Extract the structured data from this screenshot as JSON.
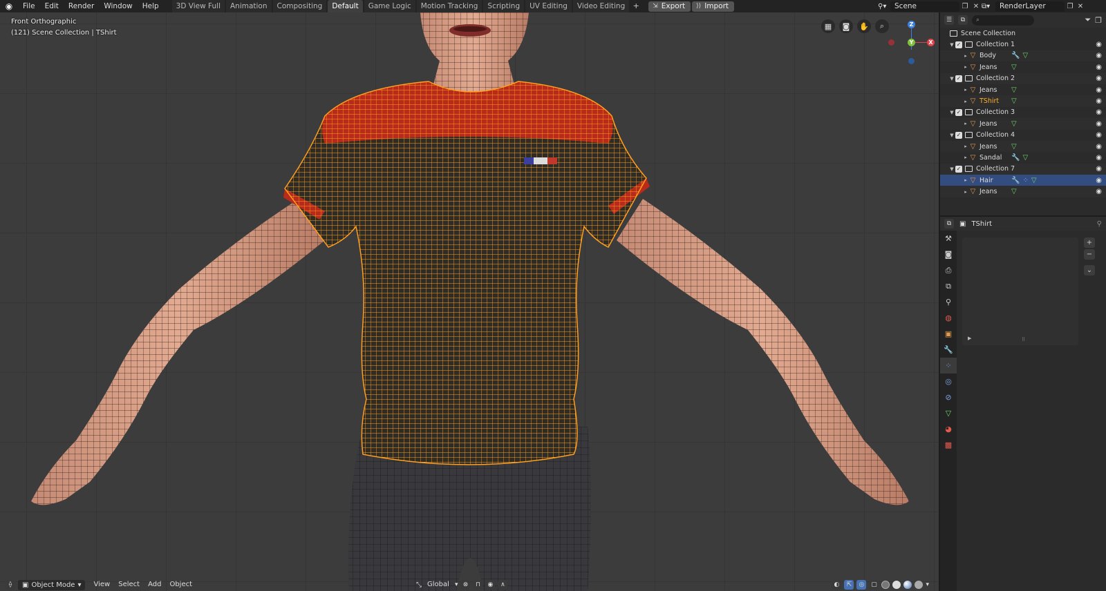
{
  "topbar": {
    "menus": [
      "File",
      "Edit",
      "Render",
      "Window",
      "Help"
    ],
    "workspaces": [
      "3D View Full",
      "Animation",
      "Compositing",
      "Default",
      "Game Logic",
      "Motion Tracking",
      "Scripting",
      "UV Editing",
      "Video Editing"
    ],
    "active_workspace": "Default",
    "add_tab": "+",
    "export_label": "Export",
    "import_label": "Import",
    "scene": "Scene",
    "render_layer": "RenderLayer"
  },
  "viewport": {
    "view_name": "Front Orthographic",
    "collection_info": "(121) Scene Collection | TShirt",
    "gizmo": {
      "x": "X",
      "y": "Y",
      "z": "Z"
    }
  },
  "viewport_header": {
    "mode": "Object Mode",
    "menus": [
      "View",
      "Select",
      "Add",
      "Object"
    ],
    "transform_orientation": "Global"
  },
  "outliner": {
    "root": "Scene Collection",
    "rows": [
      {
        "type": "collection",
        "name": "Collection 1"
      },
      {
        "type": "object",
        "name": "Body",
        "modifier": true,
        "mesh": true
      },
      {
        "type": "object",
        "name": "Jeans",
        "mesh": true
      },
      {
        "type": "collection",
        "name": "Collection 2"
      },
      {
        "type": "object",
        "name": "Jeans",
        "mesh": true
      },
      {
        "type": "object",
        "name": "TShirt",
        "mesh": true,
        "active": true
      },
      {
        "type": "collection",
        "name": "Collection 3"
      },
      {
        "type": "object",
        "name": "Jeans",
        "mesh": true
      },
      {
        "type": "collection",
        "name": "Collection 4"
      },
      {
        "type": "object",
        "name": "Jeans",
        "mesh": true
      },
      {
        "type": "object",
        "name": "Sandal",
        "modifier": true,
        "mesh": true
      },
      {
        "type": "collection",
        "name": "Collection 7"
      },
      {
        "type": "object",
        "name": "Hair",
        "modifier": true,
        "particles": true,
        "mesh": true,
        "selected": true
      },
      {
        "type": "object",
        "name": "Jeans",
        "mesh": true
      }
    ]
  },
  "properties": {
    "object_name": "TShirt",
    "tabs": [
      "tool",
      "render",
      "output",
      "view-layer",
      "scene",
      "world",
      "object",
      "modifier",
      "particles",
      "physics",
      "constraints",
      "data",
      "material",
      "texture"
    ],
    "active_tab": "particles"
  },
  "colors": {
    "wire_selected": "#ff9e1f",
    "shirt_red": "#b82a1a",
    "skin": "#d79a80",
    "gizmo_x": "#e0434b",
    "gizmo_y": "#7fc13b",
    "gizmo_z": "#3b82e0",
    "outliner_selected": "#334d80",
    "active_object": "#ffaf29"
  }
}
